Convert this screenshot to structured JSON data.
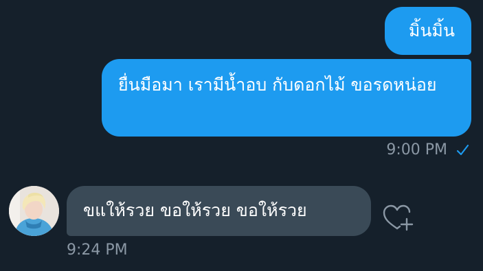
{
  "messages": {
    "sent": [
      {
        "text": "มิ้นมิ้น"
      },
      {
        "text": "ยื่นมือมา เรามีน้ำอบ กับดอกไม้ ขอรดหน่อย"
      }
    ],
    "sent_time": "9:00 PM",
    "received": {
      "text": "ขแให้รวย ขอให้รวย ขอให้รวย"
    },
    "received_time": "9:24 PM"
  },
  "icons": {
    "status": "check-icon",
    "reaction": "heart-plus-icon",
    "avatar": "profile-avatar"
  },
  "colors": {
    "background": "#15202b",
    "sent_bubble": "#1d9bf0",
    "received_bubble": "#3a4a57",
    "meta_text": "#8b98a5",
    "check": "#1d9bf0"
  }
}
